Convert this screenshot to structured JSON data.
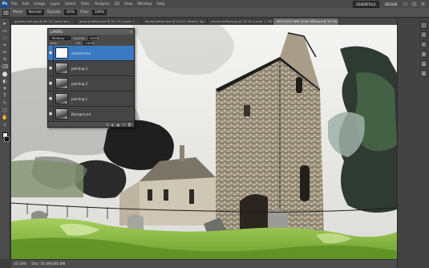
{
  "menubar": {
    "logo": "Ps",
    "items": [
      "File",
      "Edit",
      "Image",
      "Layer",
      "Select",
      "Filter",
      "Analysis",
      "3D",
      "View",
      "Window",
      "Help"
    ],
    "workspaces": [
      "ESSENTIALS",
      "DESIGN"
    ],
    "window_buttons": [
      "–",
      "□",
      "×"
    ]
  },
  "optionsbar": {
    "mode_label": "Mode:",
    "mode_value": "Normal",
    "opacity_label": "Opacity:",
    "opacity_value": "60%",
    "flow_label": "Flow:",
    "flow_value": "100%"
  },
  "doctabs": [
    {
      "label": "gazebo tree.jpg @ 66.7% (paint bru...",
      "active": false
    },
    {
      "label": "ground-effect.psd @ 50.1% (Layer 1, ...",
      "active": false
    },
    {
      "label": "house-before.psd @ 28.5% (Sketch lay...",
      "active": false
    },
    {
      "label": "church-before.jpg @ 33.3% (Layer 1, RGB...",
      "active": false
    },
    {
      "label": "20121030 HDR 2046 HDR.psd @ 33.3% (sketch line, RGB/8)",
      "active": true
    }
  ],
  "toolbox": {
    "tools": [
      "▸",
      "▭",
      "◌",
      "⌖",
      "✂",
      "✎",
      "⌫",
      "⬤",
      "◐",
      "✦",
      "T",
      "↖",
      "▢",
      "✋",
      "⌕"
    ]
  },
  "layers_panel": {
    "title": "LAYERS",
    "close": "×",
    "blend_mode": "Multiply",
    "opacity_label": "Opacity:",
    "opacity_value": "100%",
    "lock_label": "Lock:",
    "fill_label": "Fill:",
    "fill_value": "100%",
    "layers": [
      {
        "name": "sketch lines",
        "active": true,
        "thumb": "white"
      },
      {
        "name": "painting 3",
        "active": false,
        "thumb": "bw"
      },
      {
        "name": "painting 2",
        "active": false,
        "thumb": "bw"
      },
      {
        "name": "painting 1",
        "active": false,
        "thumb": "bw"
      },
      {
        "name": "Background",
        "active": false,
        "thumb": "bw"
      }
    ],
    "footer_icons": [
      "fx",
      "◐",
      "▣",
      "❐",
      "🗑"
    ]
  },
  "rightdock": {
    "icons": [
      "◫",
      "☰",
      "≋",
      "◍",
      "▤",
      "▥"
    ]
  },
  "statusbar": {
    "zoom": "33.33%",
    "doc_info": "Doc: 50.6M/385.8M"
  }
}
